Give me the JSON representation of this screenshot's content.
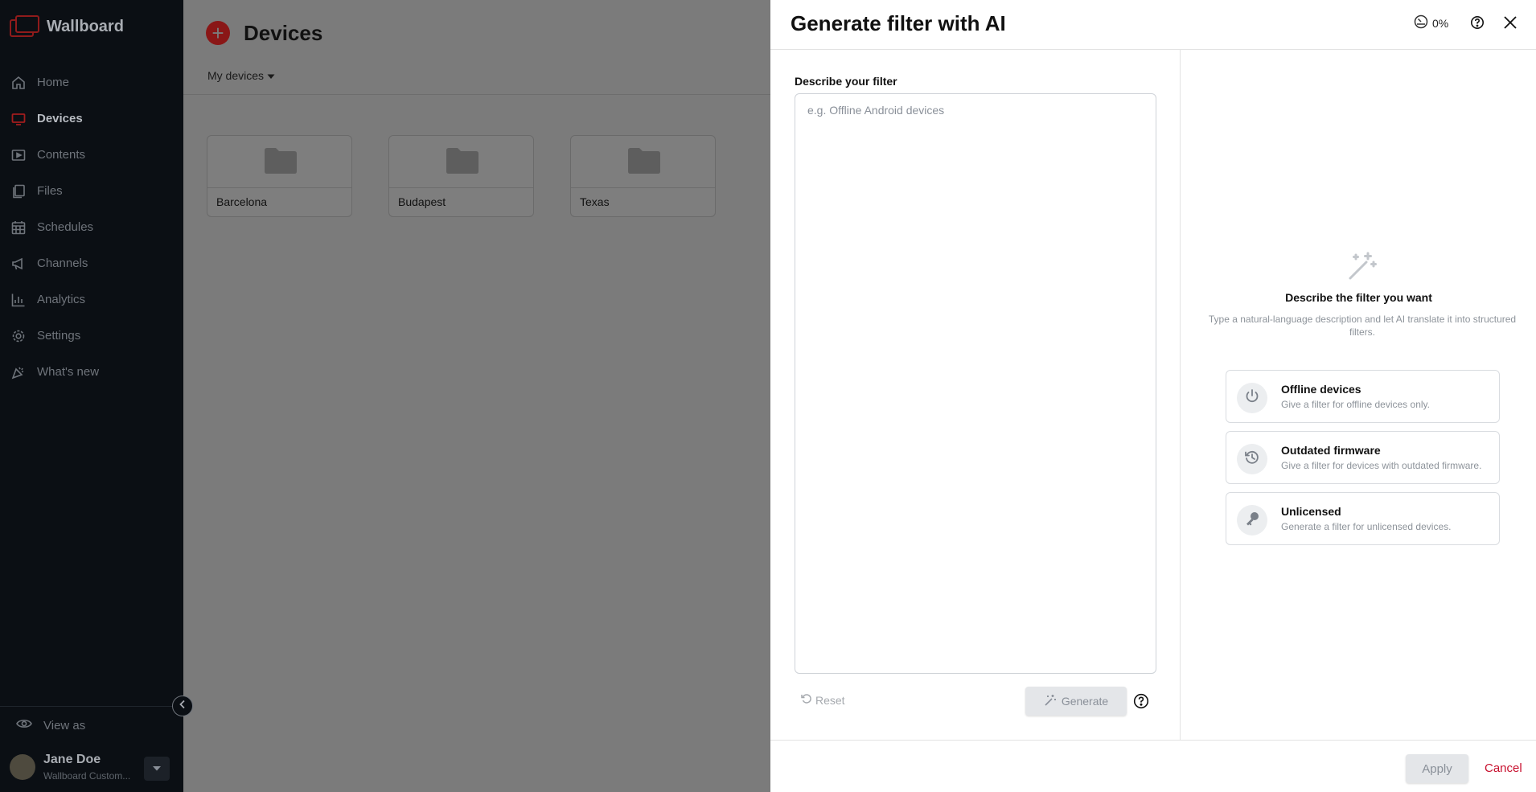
{
  "app": {
    "logo_text": "Wallboard",
    "brand_color": "#8f1b1b"
  },
  "sidebar": {
    "items": [
      {
        "label": "Home",
        "icon": "home-icon"
      },
      {
        "label": "Devices",
        "icon": "monitor-icon",
        "active": true
      },
      {
        "label": "Contents",
        "icon": "play-icon"
      },
      {
        "label": "Files",
        "icon": "files-icon"
      },
      {
        "label": "Schedules",
        "icon": "calendar-icon"
      },
      {
        "label": "Channels",
        "icon": "megaphone-icon"
      },
      {
        "label": "Analytics",
        "icon": "chart-icon"
      },
      {
        "label": "Settings",
        "icon": "gear-icon"
      },
      {
        "label": "What's new",
        "icon": "party-icon"
      }
    ],
    "view_as": "View as",
    "user": {
      "name": "Jane Doe",
      "org": "Wallboard Custom..."
    }
  },
  "main": {
    "title": "Devices",
    "filter_label": "My devices",
    "folders": [
      {
        "name": "Barcelona"
      },
      {
        "name": "Budapest"
      },
      {
        "name": "Texas"
      }
    ]
  },
  "drawer": {
    "title": "Generate filter with AI",
    "credit": "0%",
    "field_label": "Describe your filter",
    "textarea": {
      "value": "",
      "placeholder": "e.g. Offline Android devices"
    },
    "reset_label": "Reset",
    "generate_label": "Generate",
    "empty_title": "Describe the filter you want",
    "empty_desc": "Type a natural-language description and let AI translate it into structured filters.",
    "suggestions": [
      {
        "title": "Offline devices",
        "desc": "Give a filter for offline devices only.",
        "icon": "power-icon"
      },
      {
        "title": "Outdated firmware",
        "desc": "Give a filter for devices with outdated firmware.",
        "icon": "history-icon"
      },
      {
        "title": "Unlicensed",
        "desc": "Generate a filter for unlicensed devices.",
        "icon": "key-icon"
      }
    ],
    "apply_label": "Apply",
    "cancel_label": "Cancel",
    "cancel_color": "#c8102e"
  }
}
